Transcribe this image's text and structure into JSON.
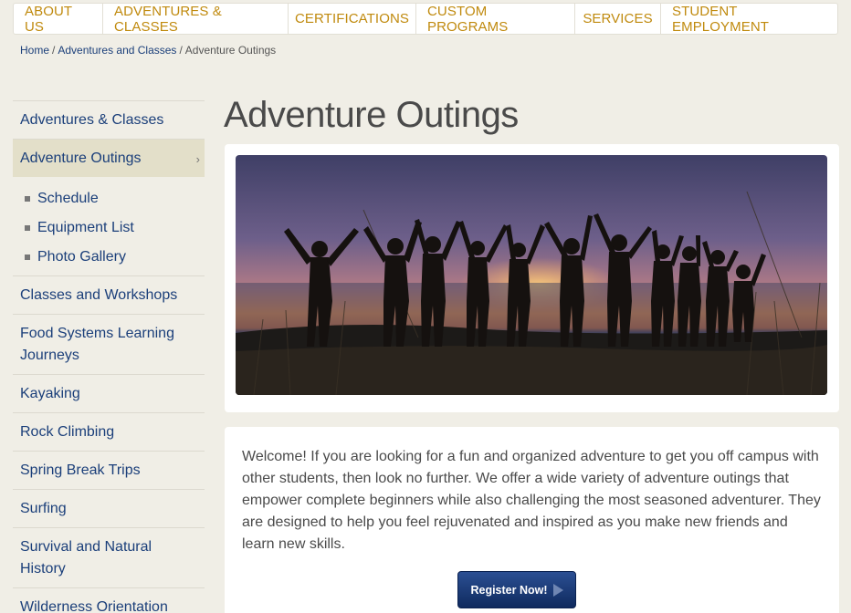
{
  "topnav": {
    "items": [
      "ABOUT US",
      "ADVENTURES & CLASSES",
      "CERTIFICATIONS",
      "CUSTOM PROGRAMS",
      "SERVICES",
      "STUDENT EMPLOYMENT"
    ]
  },
  "breadcrumb": {
    "home": "Home",
    "section": "Adventures and Classes",
    "current": "Adventure Outings",
    "separator": "/"
  },
  "sidebar": {
    "top": "Adventures & Classes",
    "active": "Adventure Outings",
    "active_chevron": "›",
    "subitems": [
      "Schedule",
      "Equipment List",
      "Photo Gallery"
    ],
    "items": [
      "Classes and Workshops",
      "Food Systems Learning Journeys",
      "Kayaking",
      "Rock Climbing",
      "Spring Break Trips",
      "Surfing",
      "Survival and Natural History",
      "Wilderness Orientation"
    ]
  },
  "main": {
    "title": "Adventure Outings",
    "hero_image": "group-silhouette-sunset",
    "intro": "Welcome!  If you are looking for a fun and organized adventure to get you off campus with other students, then look no further.  We offer a wide variety of adventure outings that empower complete beginners while also challenging the most seasoned adventurer. They are designed to help you feel rejuvenated and inspired as you make new friends and learn new skills.",
    "register_label": "Register Now!"
  },
  "colors": {
    "background": "#f0eee6",
    "nav_text": "#c08a0e",
    "link": "#1b3f7a",
    "active_bg": "#e3dfc9",
    "button": "#1a3a78"
  }
}
